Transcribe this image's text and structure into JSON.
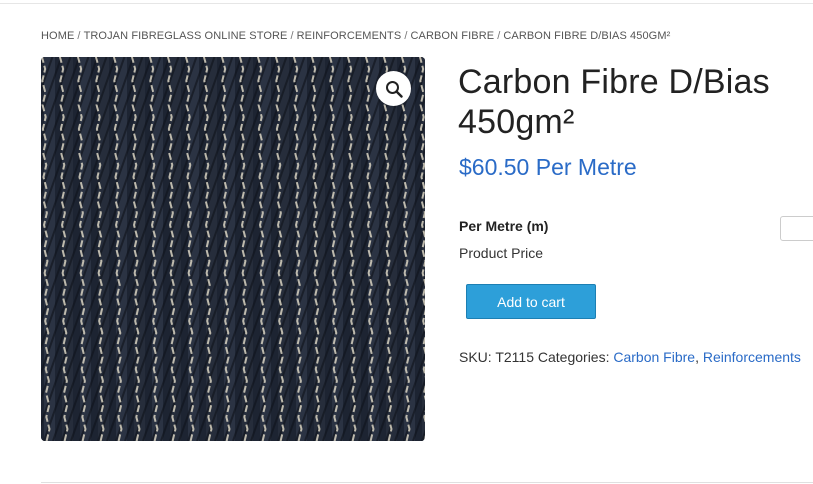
{
  "breadcrumb": {
    "items": [
      "HOME",
      "TROJAN FIBREGLASS ONLINE STORE",
      "REINFORCEMENTS",
      "CARBON FIBRE",
      "CARBON FIBRE D/BIAS 450GM²"
    ],
    "separator": "/"
  },
  "product": {
    "title": "Carbon Fibre D/Bias 450gm²",
    "price": "$60.50 Per Metre",
    "option_label": "Per Metre (m)",
    "option_value": "",
    "product_price_label": "Product Price",
    "add_to_cart_label": "Add to cart",
    "sku_label": "SKU:",
    "sku": "T2115",
    "categories_label": "Categories:",
    "categories": [
      "Carbon Fibre",
      "Reinforcements"
    ],
    "category_separator": ","
  },
  "icons": {
    "zoom": "magnifier-icon"
  },
  "colors": {
    "price": "#2a6bc7",
    "link": "#2a6bc7",
    "button": "#2d9fd9"
  }
}
